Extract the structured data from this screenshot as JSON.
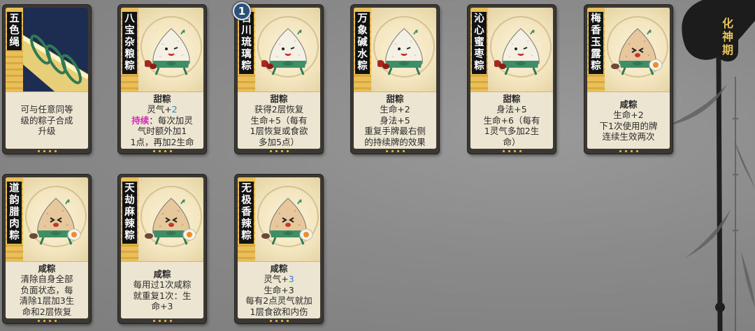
{
  "realm_label": "化神期",
  "duplicate_badge": "1",
  "cards": [
    {
      "name": "五色绳",
      "art": "rope",
      "lines": [
        {
          "t": "可与任意同等"
        },
        {
          "t": "级的粽子合成"
        },
        {
          "t": "升级"
        }
      ]
    },
    {
      "name": "八宝杂粮粽",
      "art": "sweet",
      "lines": [
        {
          "t": "甜粽",
          "b": 1
        },
        {
          "p": [
            {
              "t": "灵气+"
            },
            {
              "t": "2",
              "c": "blue"
            }
          ]
        },
        {
          "p": [
            {
              "t": "持续",
              "c": "mag"
            },
            {
              "t": "：每次加灵"
            }
          ]
        },
        {
          "t": "气时额外加1"
        },
        {
          "t": "1点，再加2生命"
        }
      ]
    },
    {
      "name": "百川琉璃粽",
      "art": "sweet",
      "lines": [
        {
          "t": "甜粽",
          "b": 1
        },
        {
          "t": "获得2层恢复"
        },
        {
          "t": "生命+5（每有"
        },
        {
          "t": "1层恢复或食欲"
        },
        {
          "t": "多加5点）"
        }
      ]
    },
    {
      "name": "万象碱水粽",
      "art": "sweet",
      "lines": [
        {
          "t": "甜粽",
          "b": 1
        },
        {
          "t": "生命+2"
        },
        {
          "t": "身法+5"
        },
        {
          "t": "重复手牌最右侧"
        },
        {
          "t": "的持续牌的效果"
        }
      ]
    },
    {
      "name": "沁心蜜枣粽",
      "art": "sweet",
      "lines": [
        {
          "t": "甜粽",
          "b": 1
        },
        {
          "t": "身法+5"
        },
        {
          "t": "生命+6（每有"
        },
        {
          "t": "1灵气多加2生"
        },
        {
          "t": "命）"
        }
      ]
    },
    {
      "name": "梅香玉露粽",
      "art": "salty",
      "lines": [
        {
          "t": "咸粽",
          "b": 1
        },
        {
          "t": "生命+2"
        },
        {
          "t": "下1次使用的牌"
        },
        {
          "t": "连续生效两次"
        }
      ]
    },
    {
      "name": "道韵腊肉粽",
      "art": "salty",
      "lines": [
        {
          "t": "咸粽",
          "b": 1
        },
        {
          "t": "清除自身全部"
        },
        {
          "t": "负面状态，每"
        },
        {
          "t": "清除1层加3生"
        },
        {
          "t": "命和2层恢复"
        }
      ]
    },
    {
      "name": "天劫麻辣粽",
      "art": "salty",
      "lines": [
        {
          "t": "咸粽",
          "b": 1
        },
        {
          "t": "每用过1次咸粽"
        },
        {
          "t": "就重复1次：生"
        },
        {
          "t": "命+3"
        }
      ]
    },
    {
      "name": "无极香辣粽",
      "art": "salty",
      "lines": [
        {
          "t": "咸粽",
          "b": 1
        },
        {
          "p": [
            {
              "t": "灵气+"
            },
            {
              "t": "3",
              "c": "blue"
            }
          ]
        },
        {
          "t": "生命+3"
        },
        {
          "t": "每有2点灵气就加"
        },
        {
          "t": "1层食欲和内伤"
        }
      ]
    }
  ],
  "colors": {
    "accent": "#e2b445",
    "value_blue": "#2f7fd6",
    "keyword_magenta": "#d42fb3"
  }
}
